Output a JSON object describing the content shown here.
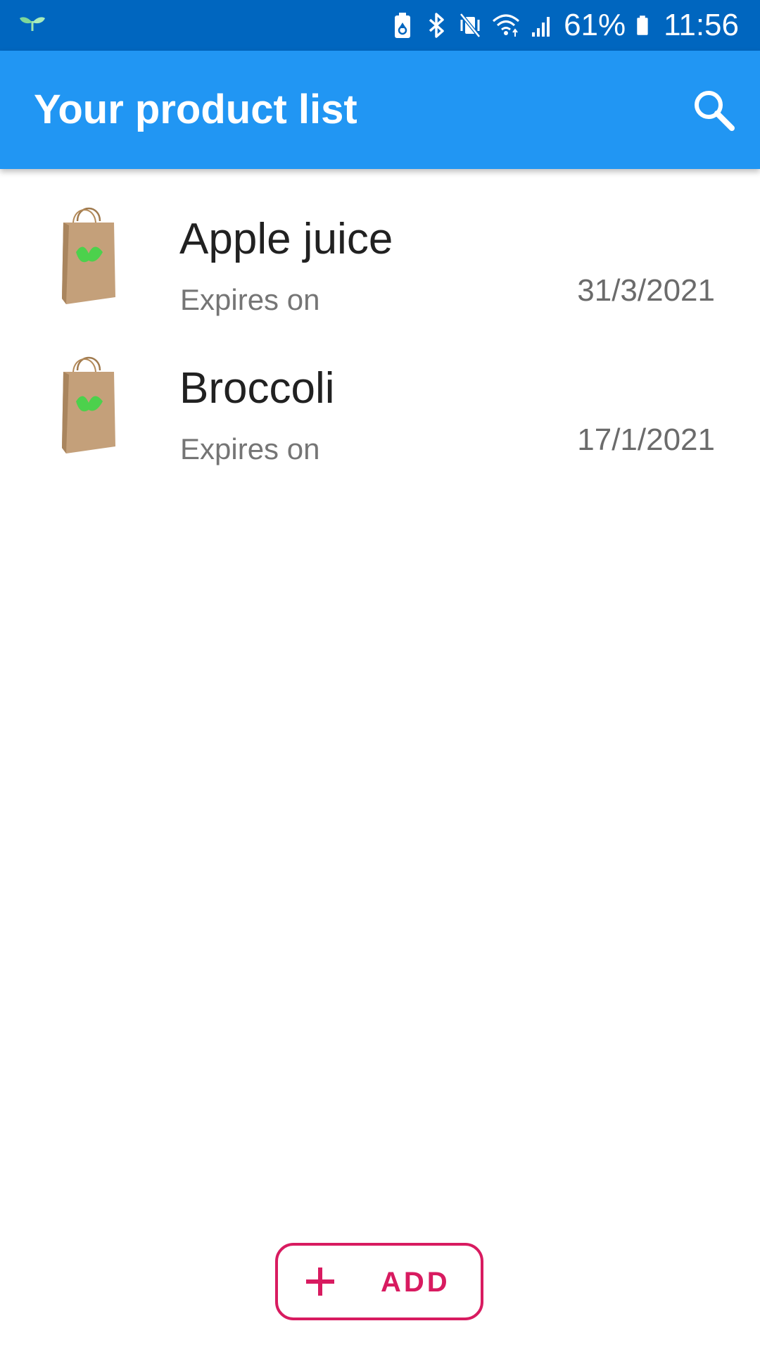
{
  "status_bar": {
    "battery_percent": "61%",
    "time": "11:56",
    "icons": [
      "app-sprout-icon",
      "battery-saver-icon",
      "bluetooth-icon",
      "vibrate-mute-icon",
      "wifi-icon",
      "cellular-signal-icon",
      "battery-icon"
    ]
  },
  "app_bar": {
    "title": "Your product list",
    "search_icon": "search-icon"
  },
  "products": [
    {
      "name": "Apple juice",
      "subtitle": "Expires on",
      "date": "31/3/2021",
      "thumb_icon": "shopping-bag-icon"
    },
    {
      "name": "Broccoli",
      "subtitle": "Expires on",
      "date": "17/1/2021",
      "thumb_icon": "shopping-bag-icon"
    }
  ],
  "add_button": {
    "label": "ADD",
    "icon": "plus-icon"
  },
  "colors": {
    "status_bar": "#0066bf",
    "app_bar": "#2196f3",
    "accent": "#d81b60",
    "leaf_green": "#4cd14c"
  }
}
